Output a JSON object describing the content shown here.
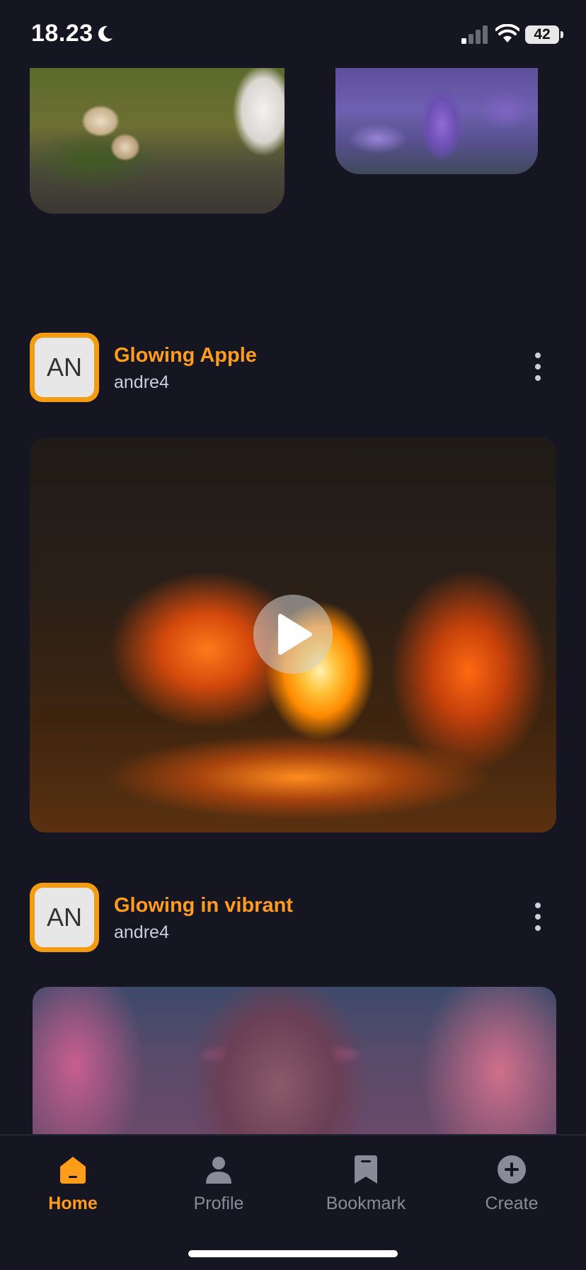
{
  "status_bar": {
    "time": "18.23",
    "battery": "42"
  },
  "posts": [
    {
      "avatar_initials": "AN",
      "title": "Glowing Apple",
      "username": "andre4",
      "media": "video"
    },
    {
      "avatar_initials": "AN",
      "title": "Glowing in vibrant",
      "username": "andre4",
      "media": "image"
    }
  ],
  "nav": {
    "items": [
      {
        "label": "Home",
        "icon": "home-icon",
        "active": true
      },
      {
        "label": "Profile",
        "icon": "profile-icon",
        "active": false
      },
      {
        "label": "Bookmark",
        "icon": "bookmark-icon",
        "active": false
      },
      {
        "label": "Create",
        "icon": "plus-circle-icon",
        "active": false
      }
    ]
  },
  "colors": {
    "background": "#161622",
    "accent": "#ff9c1a",
    "muted": "#8a8a99"
  }
}
